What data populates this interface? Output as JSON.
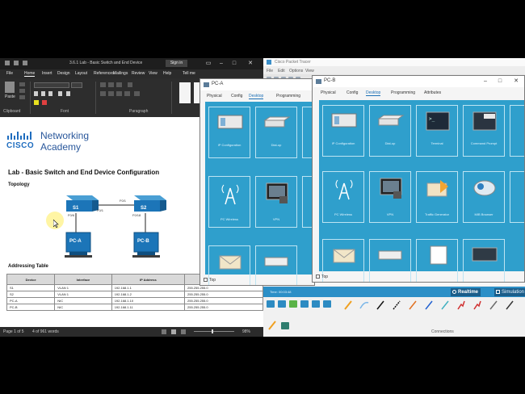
{
  "word": {
    "title": "3.6.1 Lab - Basic Switch and End Device",
    "sign_in": "Sign in",
    "tabs": [
      "File",
      "Home",
      "Insert",
      "Design",
      "Layout",
      "References",
      "Mailings",
      "Review",
      "View",
      "Help",
      "Tell me"
    ],
    "ribbon_groups": [
      "Clipboard",
      "Font",
      "Paragraph"
    ],
    "paste_label": "Paste",
    "status_page": "Page 1 of 5",
    "status_words": "4 of 961 words",
    "zoom": "98%",
    "doc": {
      "logo_word": "CISCO",
      "academy_line1": "Networking",
      "academy_line2": "Academy",
      "lab_title": "Lab - Basic Switch and End Device Configuration",
      "topology_heading": "Topology",
      "topology": {
        "s1": "S1",
        "s2": "S2",
        "pca": "PC-A",
        "pcb": "PC-B",
        "link_s1_s2": "F0/1",
        "s1_port_up": "F0/1",
        "s1_port_down": "F0/6",
        "s2_port_down": "F0/18"
      },
      "addressing_heading": "Addressing Table",
      "table_headers": [
        "Device",
        "Interface",
        "IP Address",
        "Subnet Mask"
      ],
      "table_rows": [
        [
          "S1",
          "VLAN 1",
          "192.168.1.1",
          "255.255.255.0"
        ],
        [
          "S2",
          "VLAN 1",
          "192.168.1.2",
          "255.255.255.0"
        ],
        [
          "PC-A",
          "NIC",
          "192.168.1.10",
          "255.255.255.0"
        ],
        [
          "PC-B",
          "NIC",
          "192.168.1.11",
          "255.255.255.0"
        ]
      ]
    }
  },
  "packet_tracer": {
    "title": "Cisco Packet Tracer",
    "menu": [
      "File",
      "Edit",
      "Options",
      "View",
      "Tools",
      "Extensions",
      "Help"
    ],
    "realtime": "Realtime",
    "simulation": "Simulation",
    "connections_label": "Connections",
    "time_label": "Time: 00:03:48"
  },
  "dialog_pca": {
    "title": "PC-A",
    "tabs": [
      "Physical",
      "Config",
      "Desktop",
      "Programming",
      "Attributes"
    ],
    "selected_tab": "Desktop",
    "tiles": [
      "IP Configuration",
      "Dial-up",
      "",
      "PC Wireless",
      "VPN",
      "",
      "",
      "",
      ""
    ],
    "top_check": "Top"
  },
  "dialog_pcb": {
    "title": "PC-B",
    "tabs": [
      "Physical",
      "Config",
      "Desktop",
      "Programming",
      "Attributes"
    ],
    "selected_tab": "Desktop",
    "tiles": [
      "IP Configuration",
      "Dial-up",
      "Terminal",
      "Command Prompt",
      "PC Wireless",
      "VPN",
      "Traffic Generator",
      "MIB Browser"
    ],
    "top_check": "Top"
  },
  "colors": {
    "desktop_blue": "#2f9fcc",
    "word_dark": "#2d2d2d",
    "cisco_blue": "#1f6dbf",
    "realtime_bar": "#2c8fc7"
  }
}
